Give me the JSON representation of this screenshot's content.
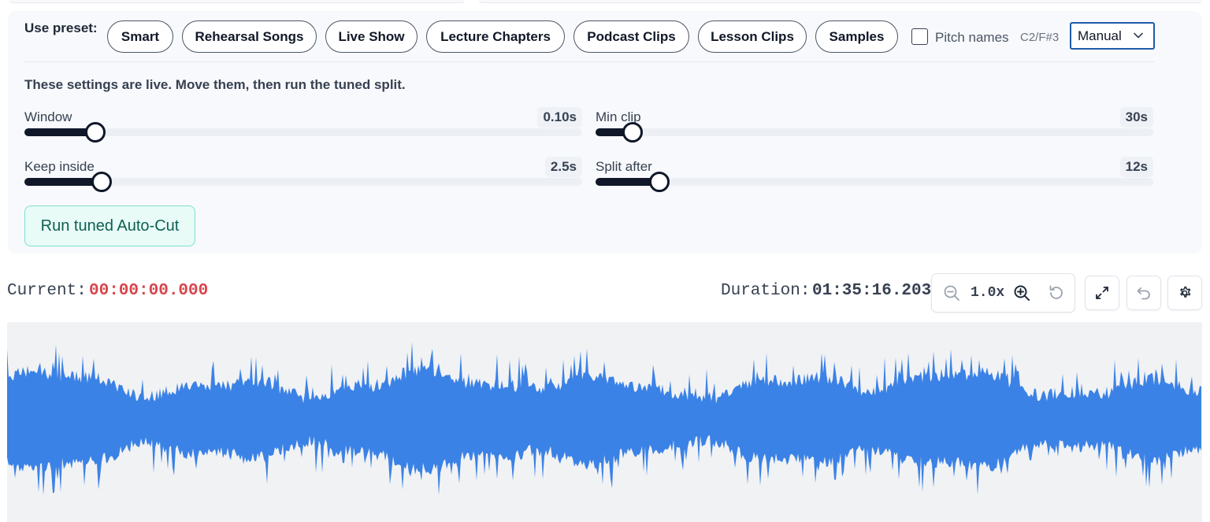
{
  "presets": {
    "label": "Use preset:",
    "items": [
      "Smart",
      "Rehearsal Songs",
      "Live Show",
      "Lecture Chapters",
      "Podcast Clips",
      "Lesson Clips",
      "Samples"
    ]
  },
  "pitch": {
    "label": "Pitch names",
    "hint": "C2/F#3",
    "checked": false
  },
  "mode": {
    "selected": "Manual"
  },
  "settings": {
    "note": "These settings are live. Move them, then run the tuned split.",
    "window": {
      "label": "Window",
      "value": "0.10s",
      "level": 0.127
    },
    "keep_inside": {
      "label": "Keep inside",
      "value": "2.5s",
      "level": 0.138
    },
    "min_clip": {
      "label": "Min clip",
      "value": "30s",
      "level": 0.066
    },
    "split_after": {
      "label": "Split after",
      "value": "12s",
      "level": 0.115
    }
  },
  "run_button": {
    "label": "Run tuned Auto-Cut"
  },
  "timeline": {
    "current_label": "Current:",
    "current_value": "00:00:00.000",
    "duration_label": "Duration:",
    "duration_value": "01:35:16.203",
    "zoom_level": "1.0x"
  },
  "icons": {
    "zoom_out": "zoom-out-icon",
    "zoom_in": "zoom-in-icon",
    "reset_zoom": "reset-zoom-icon",
    "expand": "expand-icon",
    "undo": "undo-icon",
    "settings": "gear-icon",
    "dropdown": "chevron-down-icon"
  },
  "colors": {
    "waveform": "#3b82e6",
    "current_time": "#d9434a",
    "slider_fill": "#0f1729",
    "run_button_bg": "#e8fbf6",
    "run_button_border": "#7ee0cf",
    "select_border": "#1e5aa8"
  }
}
